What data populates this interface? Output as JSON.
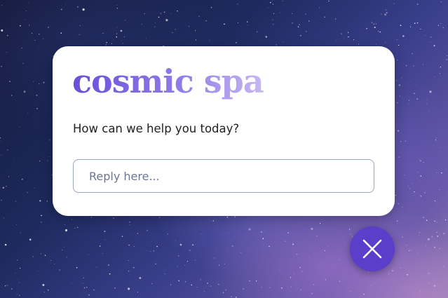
{
  "chat_widget": {
    "brand_name": "cosmic spa",
    "prompt": "How can we help you today?",
    "reply_placeholder": "Reply here...",
    "close_icon": "close-icon"
  },
  "colors": {
    "brand_gradient_start": "#6a4fd8",
    "brand_gradient_end": "#c6b8f2",
    "close_button": "#5b3ec9",
    "input_border": "#9aa4c0"
  }
}
